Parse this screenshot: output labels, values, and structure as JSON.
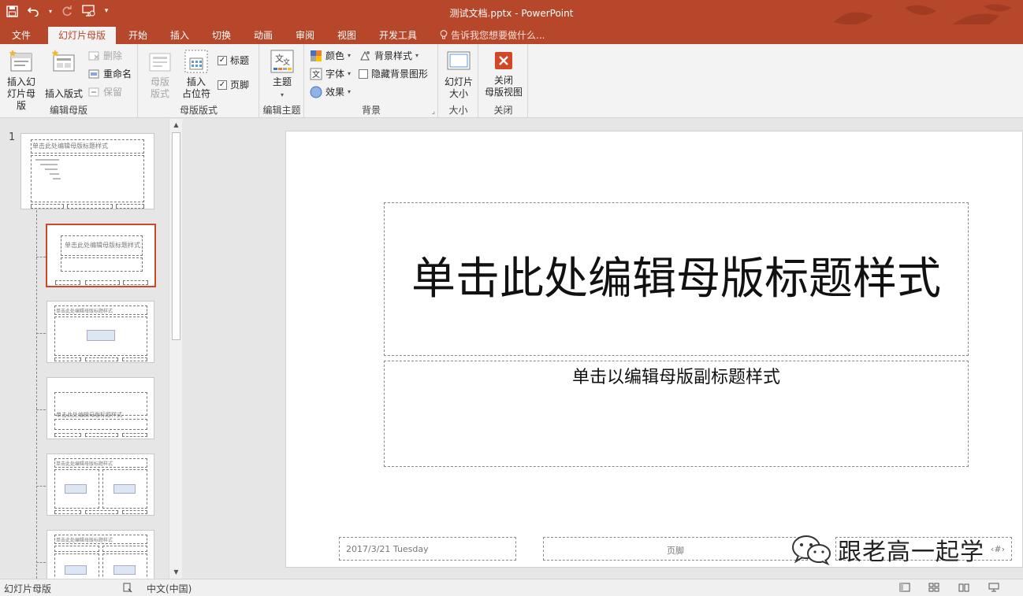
{
  "window": {
    "title": "测试文档.pptx - PowerPoint"
  },
  "tabs": [
    {
      "label": "文件"
    },
    {
      "label": "幻灯片母版"
    },
    {
      "label": "开始"
    },
    {
      "label": "插入"
    },
    {
      "label": "切换"
    },
    {
      "label": "动画"
    },
    {
      "label": "审阅"
    },
    {
      "label": "视图"
    },
    {
      "label": "开发工具"
    }
  ],
  "tell_me": "告诉我您想要做什么...",
  "ribbon": {
    "edit_master": {
      "label": "编辑母版",
      "insert_slide_master": "插入幻\n灯片母版",
      "insert_layout": "插入版式",
      "delete": "删除",
      "rename": "重命名",
      "preserve": "保留"
    },
    "master_layout": {
      "label": "母版版式",
      "layout": "母版\n版式",
      "insert_placeholder": "插入\n占位符",
      "title_check": "标题",
      "footer_check": "页脚"
    },
    "edit_theme": {
      "label": "编辑主题",
      "themes": "主题"
    },
    "background": {
      "label": "背景",
      "colors": "颜色",
      "fonts": "字体",
      "effects": "效果",
      "background_styles": "背景样式",
      "hide_background": "隐藏背景图形"
    },
    "size": {
      "label": "大小",
      "slide_size": "幻灯片\n大小"
    },
    "close": {
      "label": "关闭",
      "close_master": "关闭\n母版视图"
    }
  },
  "thumbnails": {
    "slide_number": "1",
    "master_title": "单击此处编辑母版标题样式"
  },
  "slide": {
    "title": "单击此处编辑母版标题样式",
    "subtitle": "单击以编辑母版副标题样式",
    "date": "2017/3/21 Tuesday",
    "footer": "页脚",
    "number": "‹#›"
  },
  "watermark": "跟老高一起学",
  "status": {
    "view_name": "幻灯片母版",
    "language": "中文(中国)"
  },
  "colors": {
    "accent": "#b7472a",
    "selection": "#d24726"
  }
}
